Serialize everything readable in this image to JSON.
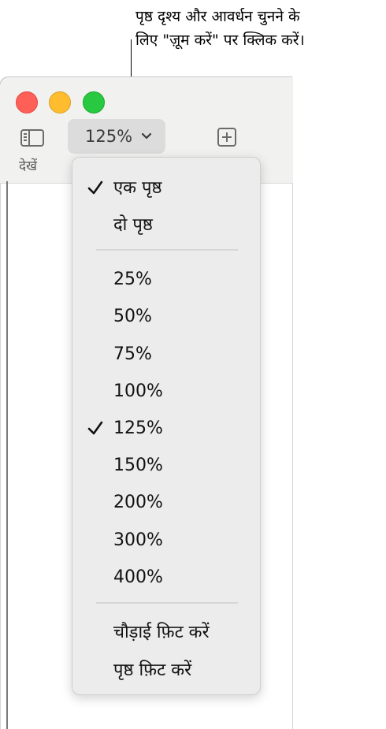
{
  "callout": {
    "line1": "पृष्ठ दृश्य और आवर्धन चुनने के",
    "line2": "लिए \"ज़ूम करें\" पर क्लिक करें।"
  },
  "window": {
    "traffic_lights": {
      "close_color": "#fe5f57",
      "minimize_color": "#febc2e",
      "maximize_color": "#28c840"
    },
    "toolbar": {
      "view_label": "देखें",
      "zoom_value": "125%",
      "view_icon": "sidebar-icon",
      "add_icon": "plus-square-icon"
    }
  },
  "menu": {
    "page_items": [
      {
        "label": "एक पृष्ठ",
        "checked": true
      },
      {
        "label": "दो पृष्ठ",
        "checked": false
      }
    ],
    "zoom_items": [
      {
        "label": "25%",
        "checked": false
      },
      {
        "label": "50%",
        "checked": false
      },
      {
        "label": "75%",
        "checked": false
      },
      {
        "label": "100%",
        "checked": false
      },
      {
        "label": "125%",
        "checked": true
      },
      {
        "label": "150%",
        "checked": false
      },
      {
        "label": "200%",
        "checked": false
      },
      {
        "label": "300%",
        "checked": false
      },
      {
        "label": "400%",
        "checked": false
      }
    ],
    "fit_items": [
      {
        "label": "चौड़ाई फ़िट करें"
      },
      {
        "label": "पृष्ठ फ़िट करें"
      }
    ]
  }
}
